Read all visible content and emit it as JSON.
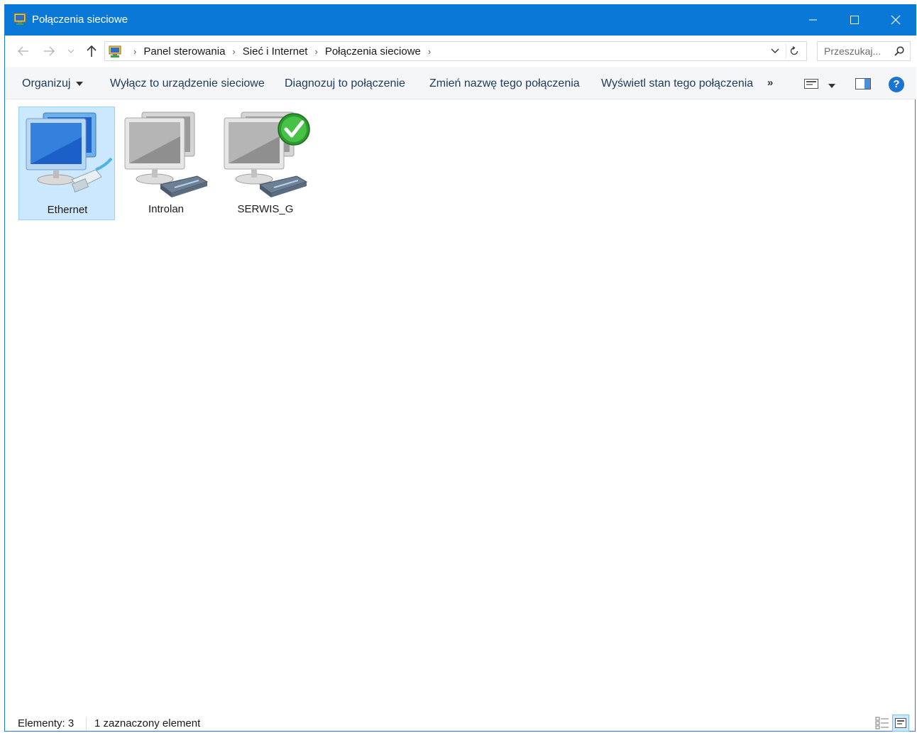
{
  "window": {
    "title": "Połączenia sieciowe"
  },
  "address": {
    "breadcrumbs": [
      "Panel sterowania",
      "Sieć i Internet",
      "Połączenia sieciowe"
    ],
    "search_placeholder": "Przeszukaj..."
  },
  "commands": {
    "organize": "Organizuj",
    "disable": "Wyłącz to urządzenie sieciowe",
    "diagnose": "Diagnozuj to połączenie",
    "rename": "Zmień nazwę tego połączenia",
    "status": "Wyświetl stan tego połączenia",
    "more": "»",
    "help": "?"
  },
  "items": [
    {
      "label": "Ethernet",
      "icon": "ethernet-adapter-icon",
      "selected": true
    },
    {
      "label": "Introlan",
      "icon": "modem-connection-icon",
      "selected": false
    },
    {
      "label": "SERWIS_G",
      "icon": "modem-connection-connected-icon",
      "selected": false
    }
  ],
  "status": {
    "count": "Elementy: 3",
    "selected": "1 zaznaczony element"
  },
  "colors": {
    "titlebar": "#0a78d7",
    "selection": "#cce8ff",
    "selection_border": "#99d1ff",
    "command_text": "#1e395b"
  }
}
